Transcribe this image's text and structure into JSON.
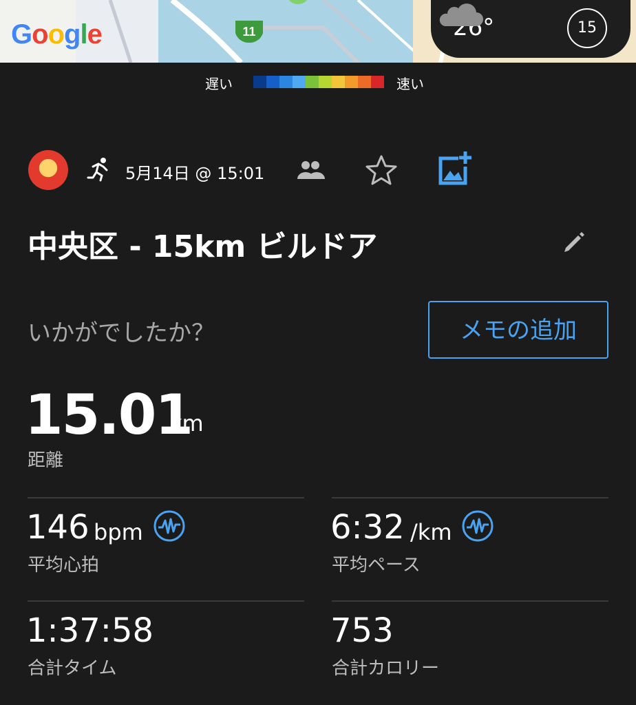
{
  "map": {
    "logo": "Google",
    "road_marker": "11",
    "weather": {
      "temperature": "26°",
      "icon": "cloud-icon"
    },
    "compass": {
      "label": "15",
      "icon": "compass-icon"
    }
  },
  "legend": {
    "slow_label": "遅い",
    "fast_label": "速い",
    "colors": [
      "#0a3a8c",
      "#1560c8",
      "#2a86e0",
      "#4fa8f0",
      "#7cc13a",
      "#b7d631",
      "#f3c63a",
      "#f39a2b",
      "#ee6b27",
      "#d9262a"
    ]
  },
  "activity": {
    "type_icon": "running-icon",
    "date": "5月14日 @ 15:01",
    "title": "中央区 - 15km ビルドア",
    "prompt": "いかがでしたか？",
    "memo_button": "メモの追加"
  },
  "stats": {
    "distance": {
      "value": "15.01",
      "unit": "km",
      "label": "距離"
    },
    "avg_heart_rate": {
      "value": "146",
      "unit": "bpm",
      "label": "平均心拍"
    },
    "avg_pace": {
      "value": "6:32",
      "unit": "/km",
      "label": "平均ペース"
    },
    "total_time": {
      "value": "1:37:58",
      "label": "合計タイム"
    },
    "total_calories": {
      "value": "753",
      "label": "合計カロリー"
    }
  },
  "colors": {
    "background": "#1b1b1b",
    "accent": "#4aa3f0"
  }
}
